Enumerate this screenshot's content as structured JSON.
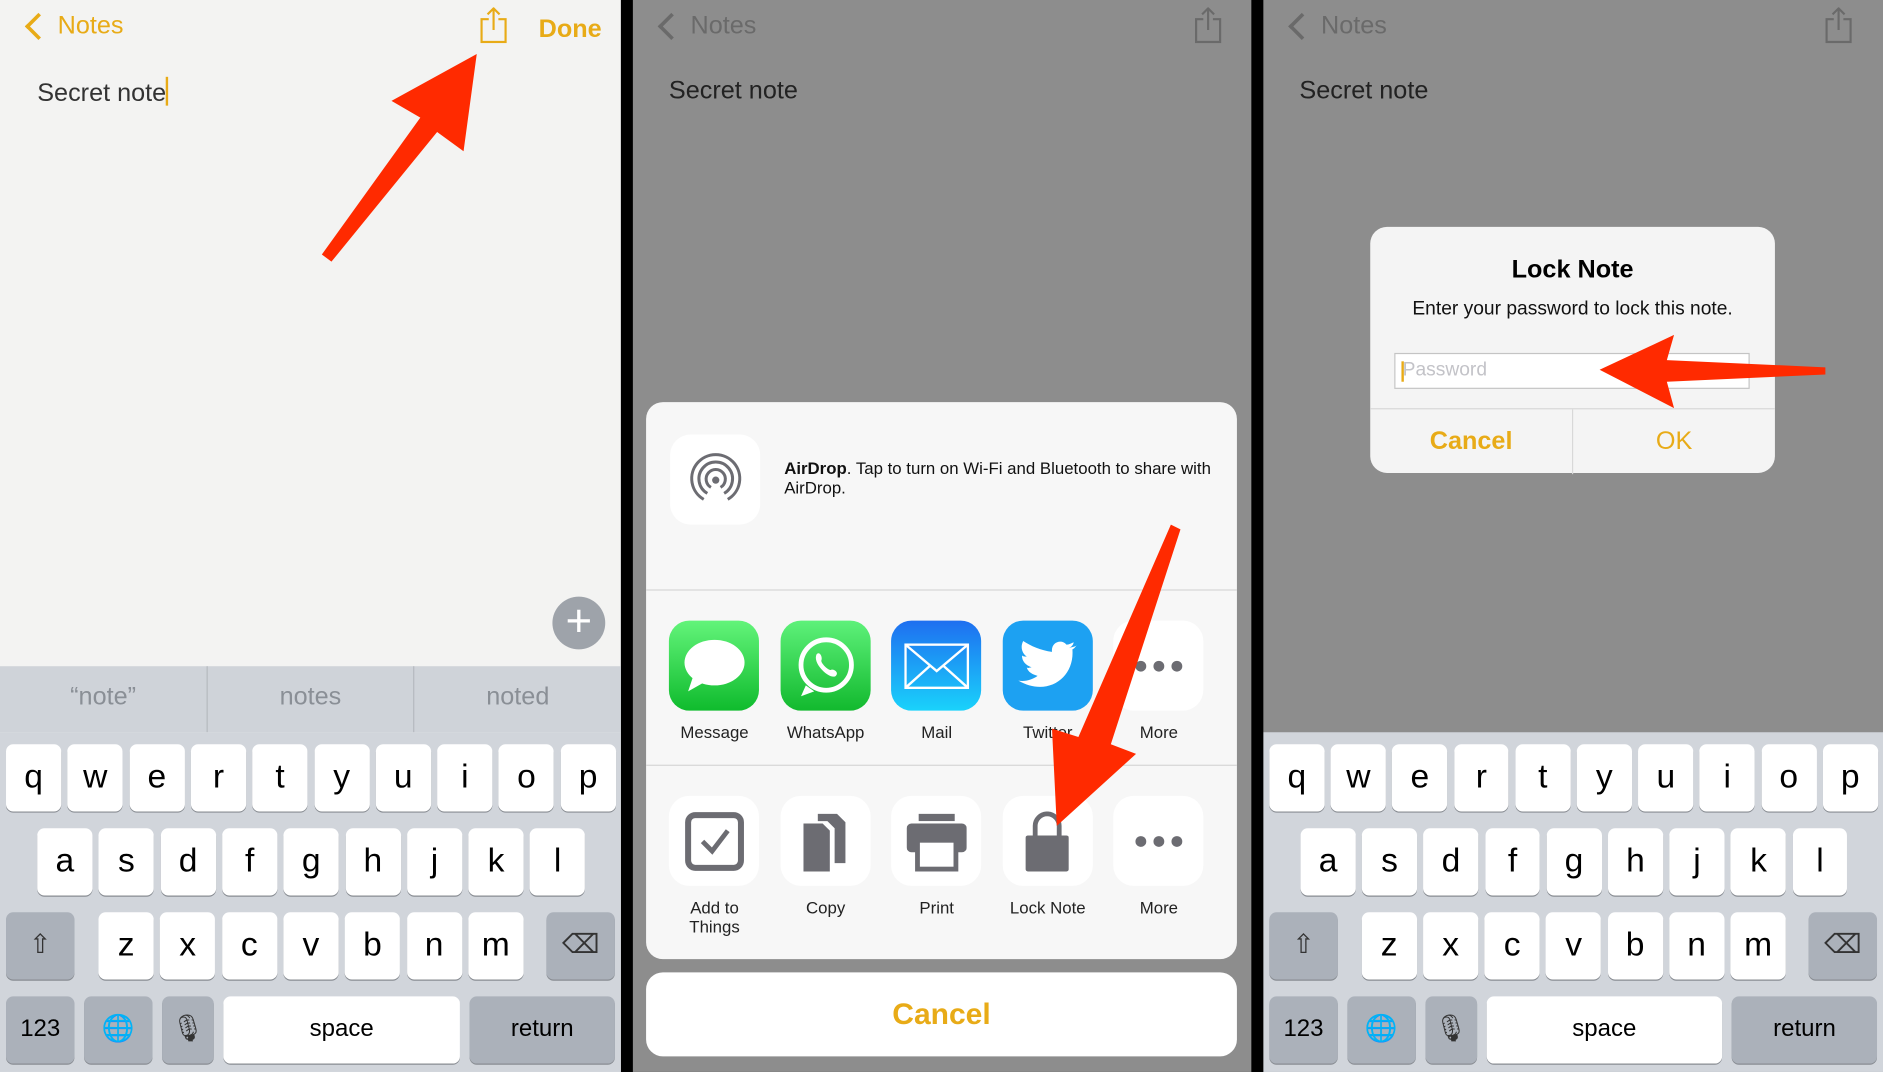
{
  "colors": {
    "accent": "#e8ab17",
    "arrow": "#ff2a00"
  },
  "panel1": {
    "back_label": "Notes",
    "done_label": "Done",
    "note_text": "Secret note",
    "suggestions": [
      "“note”",
      "notes",
      "noted"
    ]
  },
  "panel2": {
    "back_label": "Notes",
    "note_text": "Secret note",
    "airdrop": {
      "bold": "AirDrop",
      "text": ". Tap to turn on Wi-Fi and Bluetooth to share with AirDrop."
    },
    "share_apps": [
      {
        "label": "Message",
        "icon": "message-icon"
      },
      {
        "label": "WhatsApp",
        "icon": "whatsapp-icon"
      },
      {
        "label": "Mail",
        "icon": "mail-icon"
      },
      {
        "label": "Twitter",
        "icon": "twitter-icon"
      },
      {
        "label": "More",
        "icon": "more-icon"
      }
    ],
    "actions": [
      {
        "label": "Add to Things",
        "icon": "checkbox-icon"
      },
      {
        "label": "Copy",
        "icon": "copy-icon"
      },
      {
        "label": "Print",
        "icon": "print-icon"
      },
      {
        "label": "Lock Note",
        "icon": "lock-icon"
      },
      {
        "label": "More",
        "icon": "more-icon"
      }
    ],
    "cancel_label": "Cancel"
  },
  "panel3": {
    "back_label": "Notes",
    "note_text": "Secret note",
    "alert": {
      "title": "Lock Note",
      "message": "Enter your password to lock this note.",
      "placeholder": "Password",
      "cancel": "Cancel",
      "ok": "OK"
    }
  },
  "keyboard": {
    "rows": [
      [
        "q",
        "w",
        "e",
        "r",
        "t",
        "y",
        "u",
        "i",
        "o",
        "p"
      ],
      [
        "a",
        "s",
        "d",
        "f",
        "g",
        "h",
        "j",
        "k",
        "l"
      ],
      [
        "z",
        "x",
        "c",
        "v",
        "b",
        "n",
        "m"
      ]
    ],
    "numbers": "123",
    "space": "space",
    "return": "return"
  }
}
